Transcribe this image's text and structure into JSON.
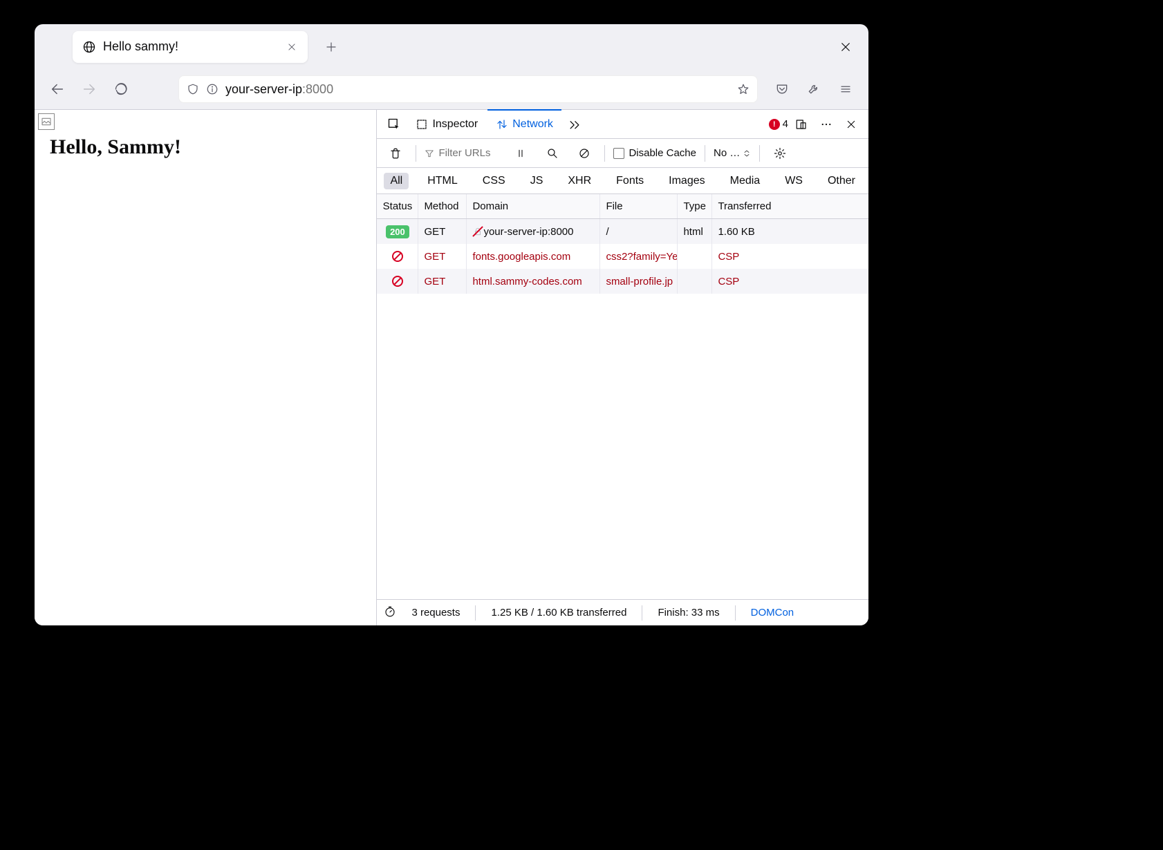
{
  "tab": {
    "title": "Hello sammy!"
  },
  "url": {
    "host": "your-server-ip",
    "port": ":8000"
  },
  "page": {
    "heading": "Hello, Sammy!"
  },
  "devtools": {
    "inspector_label": "Inspector",
    "network_label": "Network",
    "error_count": "4"
  },
  "net_toolbar": {
    "filter_placeholder": "Filter URLs",
    "disable_cache_label": "Disable Cache",
    "throttle_label": "No …"
  },
  "filters": {
    "all": "All",
    "html": "HTML",
    "css": "CSS",
    "js": "JS",
    "xhr": "XHR",
    "fonts": "Fonts",
    "images": "Images",
    "media": "Media",
    "ws": "WS",
    "other": "Other"
  },
  "headers": {
    "status": "Status",
    "method": "Method",
    "domain": "Domain",
    "file": "File",
    "type": "Type",
    "transferred": "Transferred"
  },
  "rows": [
    {
      "status": "200",
      "blocked": false,
      "method": "GET",
      "domain": "your-server-ip:8000",
      "file": "/",
      "type": "html",
      "transferred": "1.60 KB"
    },
    {
      "status": "",
      "blocked": true,
      "method": "GET",
      "domain": "fonts.googleapis.com",
      "file": "css2?family=Ye",
      "type": "",
      "transferred": "CSP"
    },
    {
      "status": "",
      "blocked": true,
      "method": "GET",
      "domain": "html.sammy-codes.com",
      "file": "small-profile.jp",
      "type": "",
      "transferred": "CSP"
    }
  ],
  "footer": {
    "requests": "3 requests",
    "transferred": "1.25 KB / 1.60 KB transferred",
    "finish": "Finish: 33 ms",
    "domcon": "DOMCon"
  }
}
